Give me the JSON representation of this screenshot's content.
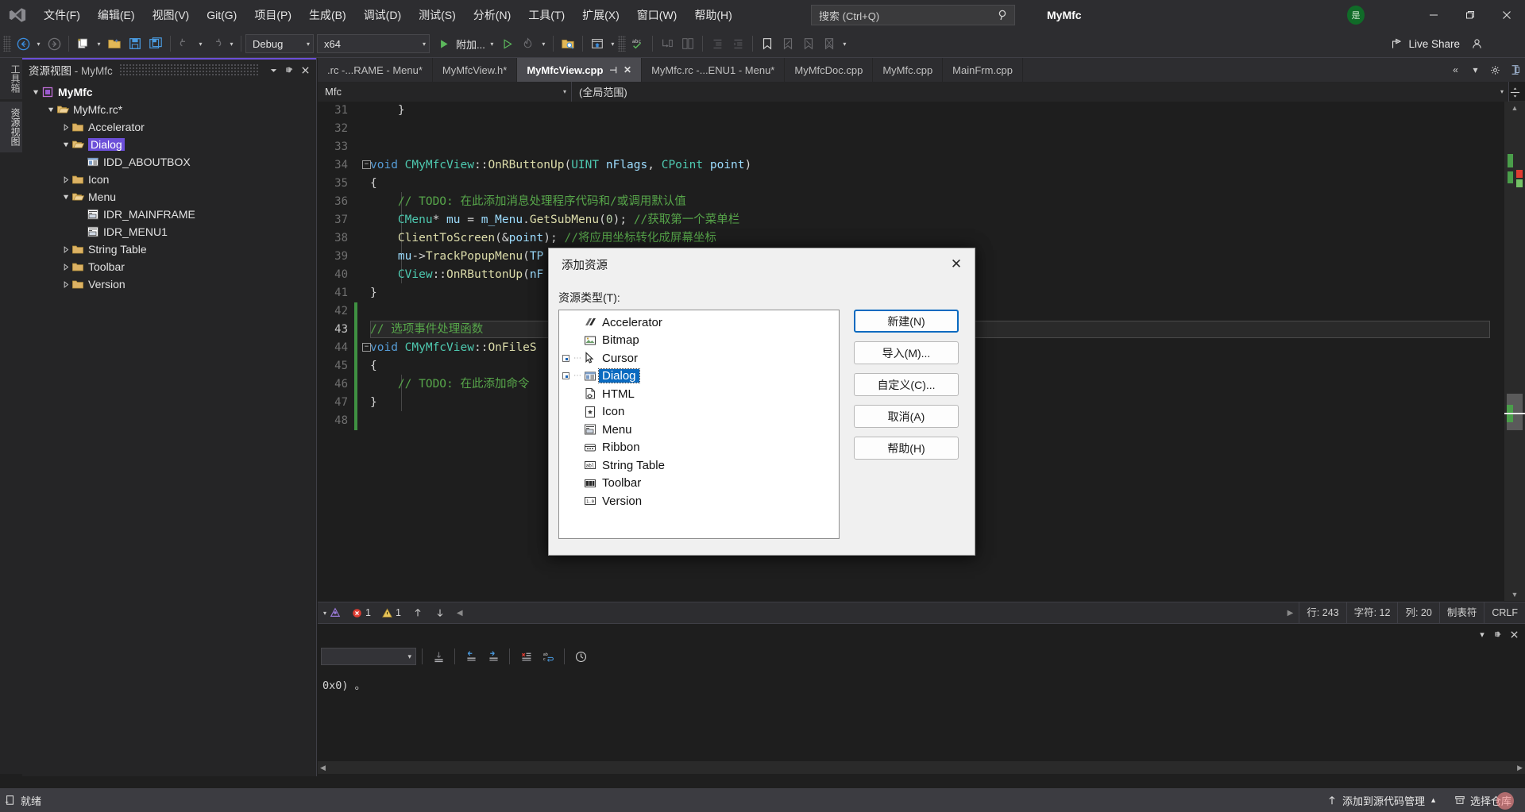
{
  "titlebar": {
    "menus": [
      "文件(F)",
      "编辑(E)",
      "视图(V)",
      "Git(G)",
      "项目(P)",
      "生成(B)",
      "调试(D)",
      "测试(S)",
      "分析(N)",
      "工具(T)",
      "扩展(X)",
      "窗口(W)",
      "帮助(H)"
    ],
    "search_placeholder": "搜索 (Ctrl+Q)",
    "app_title": "MyMfc",
    "account_badge": "是",
    "minimize": "—",
    "restore": "❐",
    "close": "✕"
  },
  "toolbar": {
    "config": "Debug",
    "platform": "x64",
    "run_label": "附加...",
    "live_share": "Live Share"
  },
  "vertical_tabs": [
    {
      "label": "工具箱",
      "selected": false
    },
    {
      "label": "资源视图",
      "selected": true
    }
  ],
  "resource_view": {
    "title_main": "资源视图",
    "title_sep": " - ",
    "title_sub": "MyMfc",
    "tree": [
      {
        "label": "MyMfc",
        "indent": 0,
        "arrow": "open",
        "icon": "solution-icon",
        "bold": true,
        "selected": false
      },
      {
        "label": "MyMfc.rc*",
        "indent": 1,
        "arrow": "open",
        "icon": "folder-open-icon",
        "bold": false,
        "selected": false
      },
      {
        "label": "Accelerator",
        "indent": 2,
        "arrow": "closed",
        "icon": "folder-icon",
        "bold": false,
        "selected": false
      },
      {
        "label": "Dialog",
        "indent": 2,
        "arrow": "open",
        "icon": "folder-open-icon",
        "bold": false,
        "selected": true
      },
      {
        "label": "IDD_ABOUTBOX",
        "indent": 3,
        "arrow": "none",
        "icon": "dialog-icon",
        "bold": false,
        "selected": false
      },
      {
        "label": "Icon",
        "indent": 2,
        "arrow": "closed",
        "icon": "folder-icon",
        "bold": false,
        "selected": false
      },
      {
        "label": "Menu",
        "indent": 2,
        "arrow": "open",
        "icon": "folder-open-icon",
        "bold": false,
        "selected": false
      },
      {
        "label": "IDR_MAINFRAME",
        "indent": 3,
        "arrow": "none",
        "icon": "menu-res-icon",
        "bold": false,
        "selected": false
      },
      {
        "label": "IDR_MENU1",
        "indent": 3,
        "arrow": "none",
        "icon": "menu-res-icon",
        "bold": false,
        "selected": false
      },
      {
        "label": "String Table",
        "indent": 2,
        "arrow": "closed",
        "icon": "folder-icon",
        "bold": false,
        "selected": false
      },
      {
        "label": "Toolbar",
        "indent": 2,
        "arrow": "closed",
        "icon": "folder-icon",
        "bold": false,
        "selected": false
      },
      {
        "label": "Version",
        "indent": 2,
        "arrow": "closed",
        "icon": "folder-icon",
        "bold": false,
        "selected": false
      }
    ]
  },
  "editor": {
    "tabs": [
      {
        "label": ".rc -...RAME - Menu*",
        "active": false
      },
      {
        "label": "MyMfcView.h*",
        "active": false
      },
      {
        "label": "MyMfcView.cpp",
        "active": true
      },
      {
        "label": "MyMfc.rc -...ENU1 - Menu*",
        "active": false
      },
      {
        "label": "MyMfcDoc.cpp",
        "active": false
      },
      {
        "label": "MyMfc.cpp",
        "active": false
      },
      {
        "label": "MainFrm.cpp",
        "active": false
      }
    ],
    "nav_left": "Mfc",
    "nav_right": "(全局范围)",
    "first_line_no": 31,
    "lines": [
      {
        "n": 31,
        "text": "    }"
      },
      {
        "n": 32,
        "text": ""
      },
      {
        "n": 33,
        "text": ""
      },
      {
        "n": 34,
        "text": "void CMyMfcView::OnRButtonUp(UINT nFlags, CPoint point)"
      },
      {
        "n": 35,
        "text": "{"
      },
      {
        "n": 36,
        "text": "    // TODO: 在此添加消息处理程序代码和/或调用默认值"
      },
      {
        "n": 37,
        "text": "    CMenu* mu = m_Menu.GetSubMenu(0); //获取第一个菜单栏"
      },
      {
        "n": 38,
        "text": "    ClientToScreen(&point); //将应用坐标转化成屏幕坐标"
      },
      {
        "n": 39,
        "text": "    mu->TrackPopupMenu(TP"
      },
      {
        "n": 40,
        "text": "    CView::OnRButtonUp(nF"
      },
      {
        "n": 41,
        "text": "}"
      },
      {
        "n": 42,
        "text": ""
      },
      {
        "n": 43,
        "text": "// 选项事件处理函数"
      },
      {
        "n": 44,
        "text": "void CMyMfcView::OnFileS"
      },
      {
        "n": 45,
        "text": "{"
      },
      {
        "n": 46,
        "text": "    // TODO: 在此添加命令"
      },
      {
        "n": 47,
        "text": "}"
      },
      {
        "n": 48,
        "text": ""
      }
    ],
    "status": {
      "error_count": "1",
      "warning_count": "1",
      "line_label": "行: 243",
      "char_label": "字符: 12",
      "col_label": "列: 20",
      "tab_label": "制表符",
      "eol_label": "CRLF"
    }
  },
  "output_pane": {
    "text": "0x0) 。"
  },
  "statusbar": {
    "ready": "就绪",
    "source_control": "添加到源代码管理",
    "repo": "选择仓库"
  },
  "dialog": {
    "title": "添加资源",
    "close_glyph": "✕",
    "list_label": "资源类型(T):",
    "items": [
      {
        "label": "Accelerator",
        "icon": "accelerator-icon",
        "expandable": false,
        "selected": false
      },
      {
        "label": "Bitmap",
        "icon": "bitmap-icon",
        "expandable": false,
        "selected": false
      },
      {
        "label": "Cursor",
        "icon": "cursor-icon",
        "expandable": true,
        "selected": false
      },
      {
        "label": "Dialog",
        "icon": "dialog-icon",
        "expandable": true,
        "selected": true
      },
      {
        "label": "HTML",
        "icon": "html-icon",
        "expandable": false,
        "selected": false
      },
      {
        "label": "Icon",
        "icon": "icon-res-icon",
        "expandable": false,
        "selected": false
      },
      {
        "label": "Menu",
        "icon": "menu-res-icon",
        "expandable": false,
        "selected": false
      },
      {
        "label": "Ribbon",
        "icon": "ribbon-icon",
        "expandable": false,
        "selected": false
      },
      {
        "label": "String Table",
        "icon": "string-table-icon",
        "expandable": false,
        "selected": false
      },
      {
        "label": "Toolbar",
        "icon": "toolbar-res-icon",
        "expandable": false,
        "selected": false
      },
      {
        "label": "Version",
        "icon": "version-icon",
        "expandable": false,
        "selected": false
      }
    ],
    "buttons": [
      {
        "label": "新建(N)",
        "primary": true
      },
      {
        "label": "导入(M)...",
        "primary": false
      },
      {
        "label": "自定义(C)...",
        "primary": false
      },
      {
        "label": "取消(A)",
        "primary": false
      },
      {
        "label": "帮助(H)",
        "primary": false
      }
    ]
  },
  "colors": {
    "accent_purple": "#6c4fd8",
    "selection_blue": "#0a6ac0",
    "error_red": "#e05252",
    "warning_yellow": "#e8c559",
    "change_green": "#3f9142"
  }
}
